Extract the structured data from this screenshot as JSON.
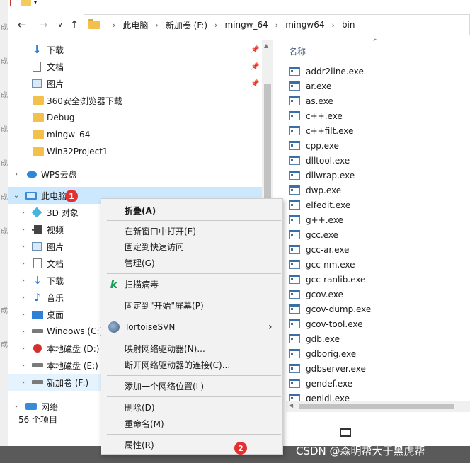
{
  "address_bar": {
    "crumbs": [
      "此电脑",
      "新加卷 (F:)",
      "mingw_64",
      "mingw64",
      "bin"
    ]
  },
  "nav_pane": {
    "quick_access": [
      {
        "label": "下载",
        "icon": "download-arrow-icon",
        "pinned": true
      },
      {
        "label": "文档",
        "icon": "document-icon",
        "pinned": true
      },
      {
        "label": "图片",
        "icon": "picture-icon",
        "pinned": true
      },
      {
        "label": "360安全浏览器下载",
        "icon": "folder-icon"
      },
      {
        "label": "Debug",
        "icon": "folder-icon"
      },
      {
        "label": "mingw_64",
        "icon": "folder-icon"
      },
      {
        "label": "Win32Project1",
        "icon": "folder-icon"
      }
    ],
    "wps": "WPS云盘",
    "this_pc": "此电脑",
    "this_pc_children": [
      {
        "label": "3D 对象",
        "icon": "3d-objects-icon"
      },
      {
        "label": "视频",
        "icon": "video-icon"
      },
      {
        "label": "图片",
        "icon": "picture-icon"
      },
      {
        "label": "文档",
        "icon": "document-icon"
      },
      {
        "label": "下载",
        "icon": "download-arrow-icon"
      },
      {
        "label": "音乐",
        "icon": "music-icon"
      },
      {
        "label": "桌面",
        "icon": "desktop-icon"
      },
      {
        "label": "Windows (C:)",
        "icon": "drive-icon"
      },
      {
        "label": "本地磁盘 (D:)",
        "icon": "drive-warning-icon"
      },
      {
        "label": "本地磁盘 (E:)",
        "icon": "drive-icon"
      },
      {
        "label": "新加卷 (F:)",
        "icon": "drive-icon"
      }
    ],
    "network": "网络"
  },
  "status": {
    "item_count": "56 个项目"
  },
  "file_list": {
    "column_name": "名称",
    "files": [
      "addr2line.exe",
      "ar.exe",
      "as.exe",
      "c++.exe",
      "c++filt.exe",
      "cpp.exe",
      "dlltool.exe",
      "dllwrap.exe",
      "dwp.exe",
      "elfedit.exe",
      "g++.exe",
      "gcc.exe",
      "gcc-ar.exe",
      "gcc-nm.exe",
      "gcc-ranlib.exe",
      "gcov.exe",
      "gcov-dump.exe",
      "gcov-tool.exe",
      "gdb.exe",
      "gdborig.exe",
      "gdbserver.exe",
      "gendef.exe",
      "genidl.exe"
    ]
  },
  "context_menu": {
    "collapse": "折叠(A)",
    "open_new_window": "在新窗口中打开(E)",
    "pin_quick_access": "固定到快速访问",
    "manage": "管理(G)",
    "scan_virus": "扫描病毒",
    "pin_start": "固定到\"开始\"屏幕(P)",
    "tortoise_svn": "TortoiseSVN",
    "map_drive": "映射网络驱动器(N)...",
    "disconnect_drive": "断开网络驱动器的连接(C)...",
    "add_network_location": "添加一个网络位置(L)",
    "delete": "删除(D)",
    "rename": "重命名(M)",
    "properties": "属性(R)"
  },
  "annotations": {
    "badge_1": "1",
    "badge_2": "2"
  },
  "watermark": "CSDN @森明帮大于黑虎帮",
  "colors": {
    "badge": "#e5302f",
    "selection": "#cce8ff",
    "accent": "#2a7bd9"
  }
}
